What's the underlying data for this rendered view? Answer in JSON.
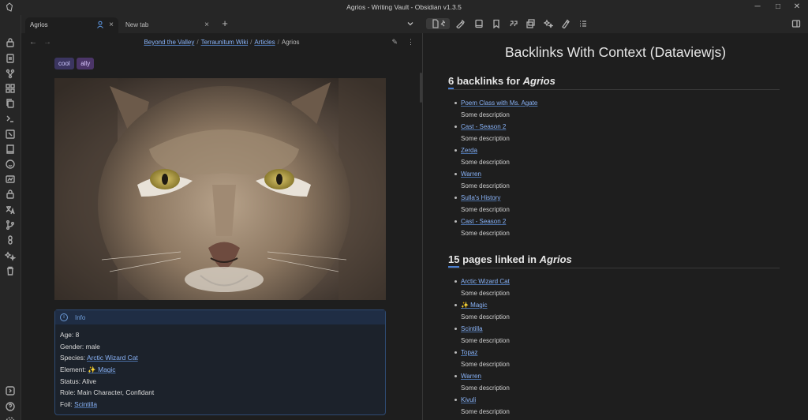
{
  "window": {
    "title": "Agrios - Writing Vault - Obsidian v1.3.5",
    "controls": [
      "─",
      "□",
      "✕"
    ]
  },
  "tabs": [
    {
      "label": "Agrios",
      "active": true
    },
    {
      "label": "New tab",
      "active": false
    }
  ],
  "breadcrumb": {
    "items": [
      "Beyond the Valley",
      "Terraunitum Wiki",
      "Articles"
    ],
    "current": "Agrios"
  },
  "note": {
    "tags": [
      "cool",
      "ally"
    ],
    "image_alt": "lynx photo",
    "callout": {
      "title": "Info",
      "lines": [
        {
          "label": "Age: ",
          "value": "8",
          "link": false
        },
        {
          "label": "Gender: ",
          "value": "male",
          "link": false
        },
        {
          "label": "Species: ",
          "value": "Arctic Wizard Cat",
          "link": true
        },
        {
          "label": "Element: ",
          "value": "✨ Magic",
          "link": true
        },
        {
          "label": "Status: ",
          "value": "Alive",
          "link": false
        },
        {
          "label": "Role: ",
          "value": "Main Character, Confidant",
          "link": false
        },
        {
          "label": "Foil: ",
          "value": "Scintilla",
          "link": true
        }
      ]
    }
  },
  "right_pane": {
    "title": "Backlinks With Context (Dataviewjs)",
    "backlinks": {
      "count": "6",
      "text": " backlinks for ",
      "target": "Agrios",
      "items": [
        {
          "link": "Poem Class with Ms. Agate",
          "desc": "Some description"
        },
        {
          "link": "Cast - Season 2",
          "desc": "Some description"
        },
        {
          "link": "Zerda",
          "desc": "Some description"
        },
        {
          "link": "Warren",
          "desc": "Some description"
        },
        {
          "link": "Sulla's History",
          "desc": "Some description"
        },
        {
          "link": "Cast - Season 2",
          "desc": "Some description"
        }
      ]
    },
    "outlinks": {
      "count": "15",
      "text": " pages linked in ",
      "target": "Agrios",
      "items": [
        {
          "link": "Arctic Wizard Cat",
          "desc": "Some description"
        },
        {
          "link": "✨ Magic",
          "desc": "Some description"
        },
        {
          "link": "Scintilla",
          "desc": "Some description"
        },
        {
          "link": "Topaz",
          "desc": "Some description"
        },
        {
          "link": "Warren",
          "desc": "Some description"
        },
        {
          "link": "Kivuli",
          "desc": "Some description"
        }
      ]
    }
  },
  "colors": {
    "accent_link": "#8ab4f8",
    "callout_border": "#2e4a72",
    "tag_cool": "#3b3560",
    "tag_ally": "#4b3568"
  }
}
